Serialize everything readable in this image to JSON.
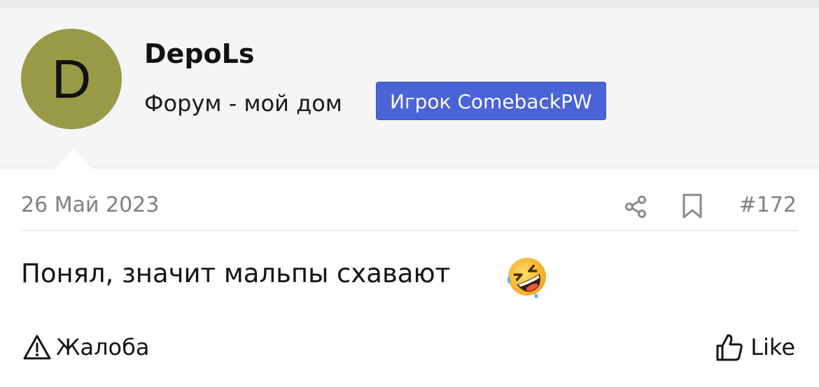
{
  "user": {
    "avatar_letter": "D",
    "avatar_color": "#999a48",
    "name": "DepoLs",
    "title": "Форум - мой дом",
    "banner": "Игрок ComebackPW",
    "banner_color": "#4a63d7"
  },
  "post": {
    "date": "26 Май 2023",
    "number": "#172",
    "message": "Понял, значит мальпы схавают",
    "emoji": "rolling-on-floor-laughing",
    "icons": {
      "share": "share-icon",
      "bookmark": "bookmark-icon"
    }
  },
  "actions": {
    "report_label": "Жалоба",
    "like_label": "Like"
  }
}
